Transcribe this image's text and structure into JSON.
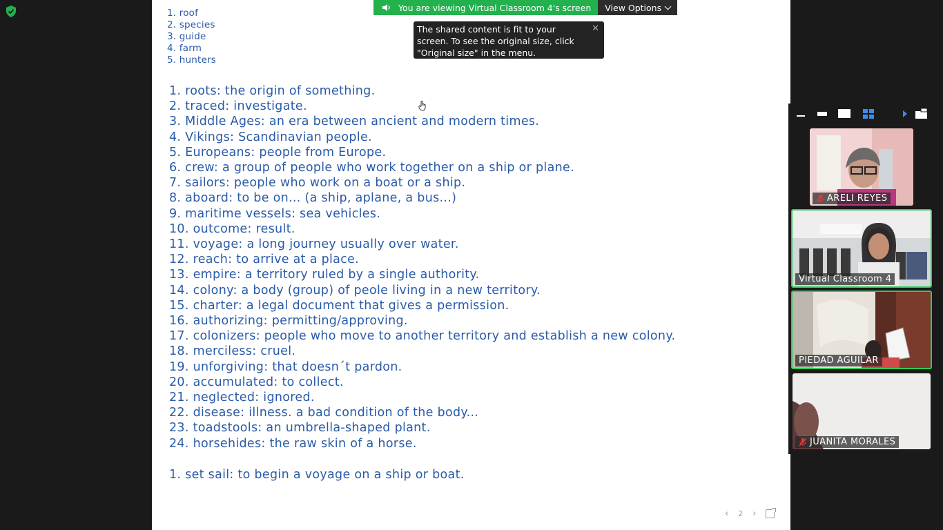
{
  "banner": {
    "viewing_text": "You are viewing Virtual Classroom 4's screen",
    "view_options_label": "View Options"
  },
  "tooltip": {
    "text": "The shared content is fit to your screen. To see the original size, click \"Original size\" in the menu."
  },
  "document": {
    "small_list": [
      "1. roof",
      "2. species",
      "3. guide",
      "4. farm",
      "5. hunters"
    ],
    "vocab": [
      "1. roots: the origin of something.",
      "2. traced: investigate.",
      "3. Middle Ages: an era between ancient and modern times.",
      "4. Vikings: Scandinavian people.",
      "5. Europeans: people from Europe.",
      "6. crew: a group of people who work together on a ship or plane.",
      "7. sailors: people who work on a boat or a ship.",
      "8. aboard: to be on... (a ship, aplane, a bus...)",
      "9. maritime vessels: sea vehicles.",
      "10. outcome: result.",
      "11. voyage: a long journey usually over water.",
      "12. reach: to arrive at a place.",
      "13. empire: a territory ruled by a single authority.",
      "14. colony: a body (group) of peole living in a new territory.",
      "15. charter: a legal document that gives a permission.",
      "16. authorizing: permitting/approving.",
      "17. colonizers: people who move to another territory and establish a new colony.",
      "18. merciless: cruel.",
      "19. unforgiving: that doesn´t pardon.",
      "20. accumulated: to collect.",
      "21. neglected: ignored.",
      "22. disease: illness. a bad condition of the body...",
      "23. toadstools: an umbrella-shaped plant.",
      "24. horsehides: the raw skin of a horse."
    ],
    "extra": [
      "1. set sail: to begin a voyage on a ship or boat."
    ],
    "page_number": "2"
  },
  "participants": [
    {
      "name": "ARELI REYES",
      "muted": true,
      "active": false
    },
    {
      "name": "Virtual Classroom 4",
      "muted": false,
      "active": true
    },
    {
      "name": "PIEDAD AGUILAR",
      "muted": false,
      "active": true
    },
    {
      "name": "JUANITA MORALES",
      "muted": true,
      "active": false
    }
  ],
  "icons": {
    "security": "shield-check-icon",
    "audio": "speaker-icon",
    "muted": "mic-muted-icon",
    "cursor": "hand-cursor-icon"
  },
  "colors": {
    "doc_text": "#2a5ba8",
    "banner_green": "#23b14d",
    "active_speaker": "#2fcc56",
    "muted_red": "#e03b3b",
    "background": "#1a1a1a"
  }
}
